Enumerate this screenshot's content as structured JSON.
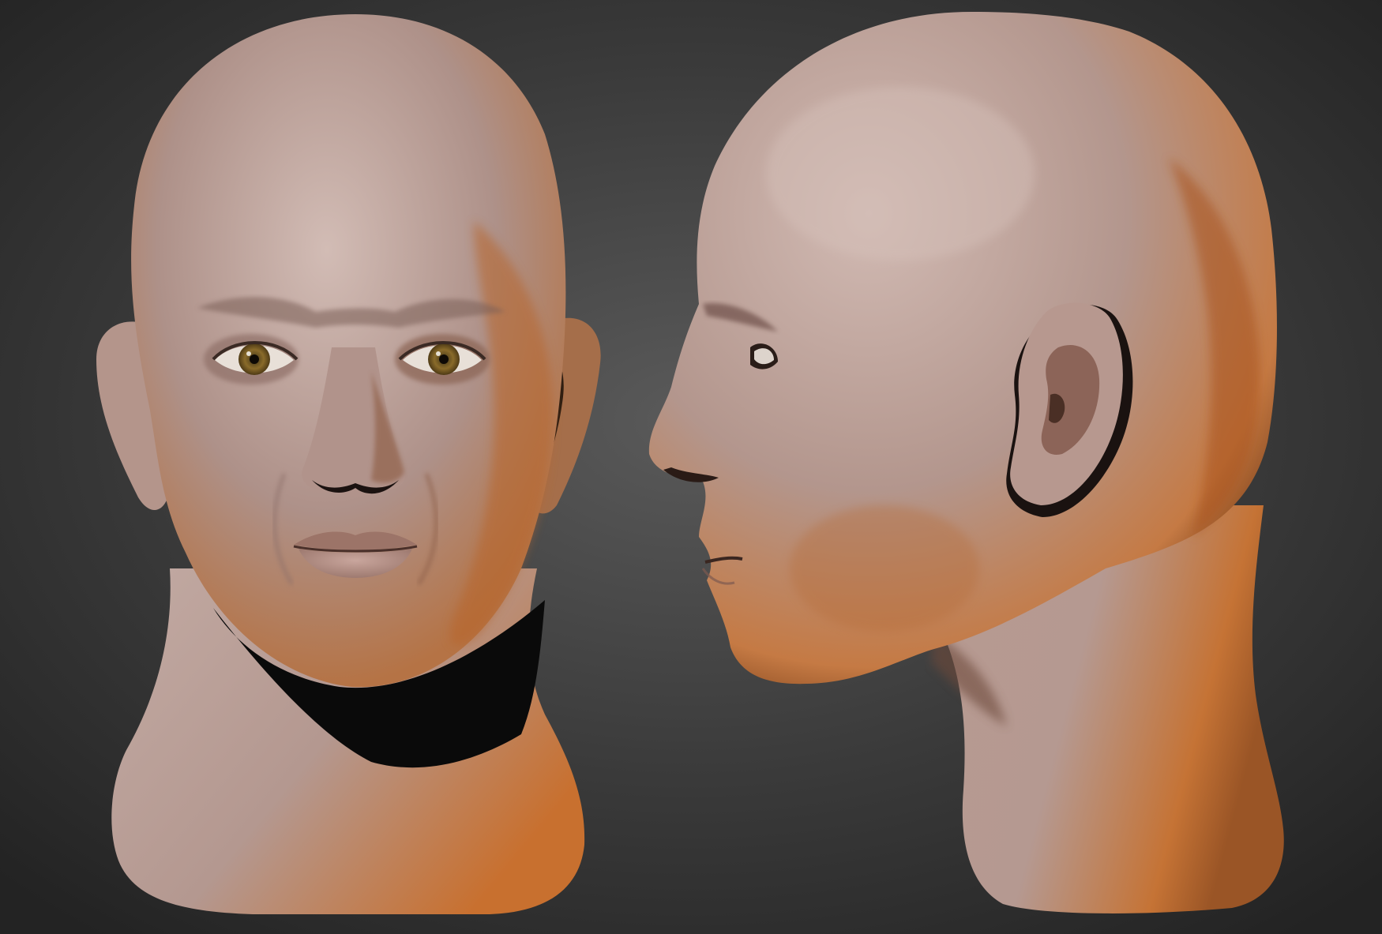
{
  "scene": {
    "background_center_color": "#5a5a5a",
    "background_edge_color": "#232323",
    "skin_light_color": "#c4aba4",
    "skin_mid_color": "#a88a80",
    "skin_warm_color": "#c7733a",
    "iris_color": "#8a6b2a",
    "views": [
      {
        "id": "front",
        "name": "front-view"
      },
      {
        "id": "side",
        "name": "side-view"
      }
    ]
  }
}
